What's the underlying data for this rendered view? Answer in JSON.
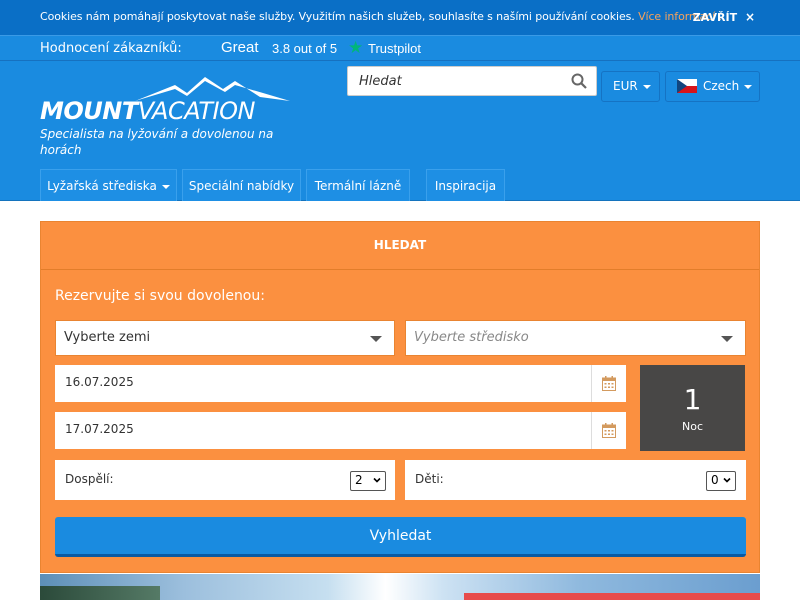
{
  "cookie": {
    "text": "Cookies nám pomáhají poskytovat naše služby. Využitím našich služeb, souhlasíte s našími používání cookies.",
    "link": "Více informací ...",
    "close": "ZAVŘÍT",
    "close_icon": "×"
  },
  "rating": {
    "label": "Hodnocení zákazníků:",
    "great": "Great",
    "score": "3.8 out of 5",
    "provider": "Trustpilot",
    "star": "★"
  },
  "logo": {
    "bold": "MOUNT",
    "thin": "VACATION",
    "tagline": "Specialista na lyžování a dovolenou na horách"
  },
  "search": {
    "placeholder": "Hledat"
  },
  "currency": "EUR",
  "language": "Czech",
  "nav": [
    {
      "label": "Lyžařská střediska"
    },
    {
      "label": "Speciální nabídky"
    },
    {
      "label": "Termální lázně"
    },
    {
      "label": "Inspiracija"
    }
  ],
  "booking": {
    "header": "HLEDAT",
    "subtitle": "Rezervujte si svou dovolenou:",
    "country_select": "Vyberte zemi",
    "resort_placeholder": "Vyberte středisko",
    "date_from": "16.07.2025",
    "date_to": "17.07.2025",
    "nights_count": "1",
    "nights_label": "Noc",
    "adults_label": "Dospělí:",
    "adults_value": "2",
    "children_label": "Děti:",
    "children_value": "0",
    "submit": "Vyhledat"
  },
  "colors": {
    "brand_blue": "#1a8be0",
    "orange": "#fb9040",
    "dark": "#484746",
    "trustpilot_green": "#00b67a"
  }
}
